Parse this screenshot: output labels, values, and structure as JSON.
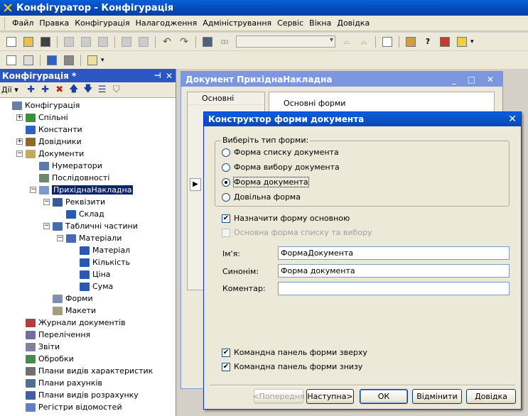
{
  "window": {
    "title": "Конфігуратор - Конфігурація"
  },
  "menu": [
    "Файл",
    "Правка",
    "Конфігурація",
    "Налагодження",
    "Адміністрування",
    "Сервіс",
    "Вікна",
    "Довідка"
  ],
  "config_panel": {
    "title": "Конфігурація *",
    "actions_label": "Дії",
    "tree": [
      {
        "label": "Конфігурація",
        "level": 0,
        "expander": "",
        "icon": "#6a7fa8"
      },
      {
        "label": "Спільні",
        "level": 1,
        "expander": "+",
        "icon": "#3c8f3c"
      },
      {
        "label": "Константи",
        "level": 1,
        "expander": "",
        "icon": "#3060c0"
      },
      {
        "label": "Довідники",
        "level": 1,
        "expander": "+",
        "icon": "#8a6a2a"
      },
      {
        "label": "Документи",
        "level": 1,
        "expander": "−",
        "icon": "#c8a860"
      },
      {
        "label": "Нумератори",
        "level": 2,
        "expander": "",
        "icon": "#5a7ab0"
      },
      {
        "label": "Послідовності",
        "level": 2,
        "expander": "",
        "icon": "#6a8a6a"
      },
      {
        "label": "ПрихіднаНакладна",
        "level": 2,
        "expander": "−",
        "icon": "#7a9ad0",
        "selected": true
      },
      {
        "label": "Реквізити",
        "level": 3,
        "expander": "−",
        "icon": "#3a5a9a"
      },
      {
        "label": "Склад",
        "level": 4,
        "expander": "",
        "icon": "#2a5ab0"
      },
      {
        "label": "Табличні частини",
        "level": 3,
        "expander": "−",
        "icon": "#4a6ab0"
      },
      {
        "label": "Матеріали",
        "level": 4,
        "expander": "−",
        "icon": "#4a6ab0"
      },
      {
        "label": "Матеріал",
        "level": 5,
        "expander": "",
        "icon": "#2a5ab0"
      },
      {
        "label": "Кількість",
        "level": 5,
        "expander": "",
        "icon": "#2a5ab0"
      },
      {
        "label": "Ціна",
        "level": 5,
        "expander": "",
        "icon": "#2a5ab0"
      },
      {
        "label": "Сума",
        "level": 5,
        "expander": "",
        "icon": "#2a5ab0"
      },
      {
        "label": "Форми",
        "level": 3,
        "expander": "",
        "icon": "#8090b0"
      },
      {
        "label": "Макети",
        "level": 3,
        "expander": "",
        "icon": "#a0a080"
      },
      {
        "label": "Журнали документів",
        "level": 1,
        "expander": "",
        "icon": "#b04040"
      },
      {
        "label": "Перелічення",
        "level": 1,
        "expander": "",
        "icon": "#7070a0"
      },
      {
        "label": "Звіти",
        "level": 1,
        "expander": "",
        "icon": "#8080a0"
      },
      {
        "label": "Обробки",
        "level": 1,
        "expander": "",
        "icon": "#4a8a4a"
      },
      {
        "label": "Плани видів характеристик",
        "level": 1,
        "expander": "",
        "icon": "#707070"
      },
      {
        "label": "Плани рахунків",
        "level": 1,
        "expander": "",
        "icon": "#507090"
      },
      {
        "label": "Плани видів розрахунку",
        "level": 1,
        "expander": "",
        "icon": "#4060a0"
      },
      {
        "label": "Регістри відомостей",
        "level": 1,
        "expander": "",
        "icon": "#6080c0"
      }
    ]
  },
  "doc_window": {
    "title": "Документ ПрихіднаНакладна",
    "tab": "Основні",
    "group_label": "Основні форми"
  },
  "dialog": {
    "title": "Конструктор форми документа",
    "group_label": "Виберіть тип форми:",
    "form_types": [
      {
        "label": "Форма списку документа",
        "selected": false
      },
      {
        "label": "Форма вибору документа",
        "selected": false
      },
      {
        "label": "Форма документа",
        "selected": true
      },
      {
        "label": "Довільна форма",
        "selected": false
      }
    ],
    "checkbox_main": {
      "label": "Назначити форму основною",
      "checked": true
    },
    "checkbox_list": {
      "label": "Основна форма списку та вибору",
      "checked": false
    },
    "name_label": "Ім'я:",
    "name_value": "ФормаДокумента",
    "synonym_label": "Синонім:",
    "synonym_value": "Форма документа",
    "comment_label": "Коментар:",
    "comment_value": "",
    "checkbox_top": {
      "label": "Командна панель форми зверху",
      "checked": true
    },
    "checkbox_bottom": {
      "label": "Командна панель форми знизу",
      "checked": true
    },
    "buttons": {
      "prev": "<Попередня",
      "next": "Наступна>",
      "ok": "ОК",
      "cancel": "Відмінити",
      "help": "Довідка"
    }
  }
}
